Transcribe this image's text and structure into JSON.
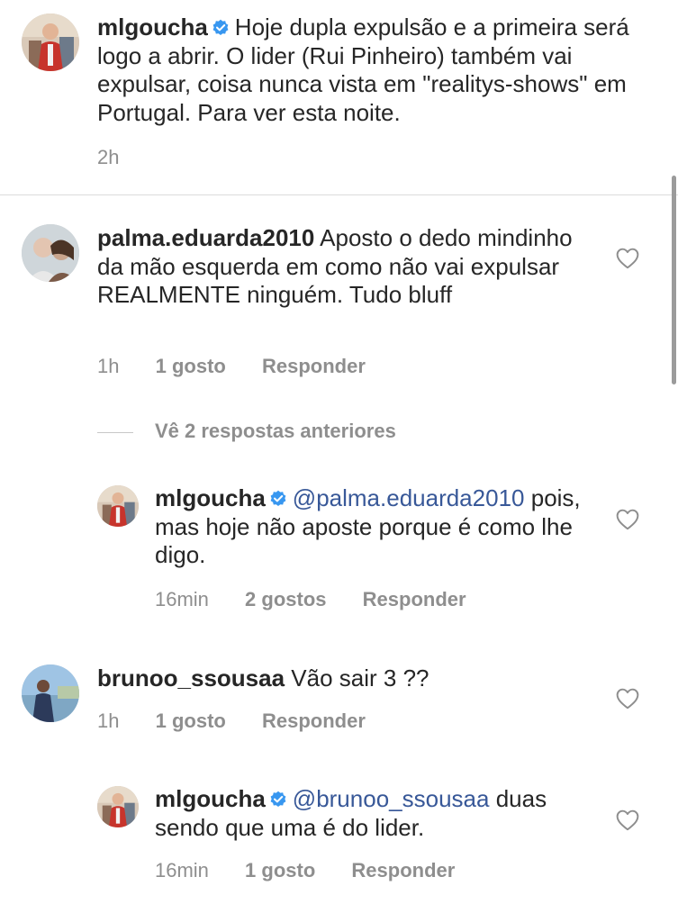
{
  "caption": {
    "username": "mlgoucha",
    "text": "Hoje  dupla expulsão e a primeira será logo a abrir. O lider (Rui Pinheiro) também vai expulsar, coisa nunca vista em \"realitys-shows\" em Portugal. Para ver esta noite.",
    "time": "2h"
  },
  "comments": [
    {
      "username": "palma.eduarda2010",
      "text": "Aposto o dedo mindinho da mão esquerda em como não vai expulsar REALMENTE ninguém. Tudo bluff",
      "time": "1h",
      "likes": "1 gosto",
      "reply_label": "Responder"
    },
    {
      "username": "brunoo_ssousaa",
      "text": "Vão sair 3 ??",
      "time": "1h",
      "likes": "1 gosto",
      "reply_label": "Responder"
    }
  ],
  "view_replies": "Vê 2 respostas anteriores",
  "replies": [
    {
      "username": "mlgoucha",
      "mention": "@palma.eduarda2010",
      "text": "pois, mas hoje não aposte porque é como lhe digo.",
      "time": "16min",
      "likes": "2 gostos",
      "reply_label": "Responder"
    },
    {
      "username": "mlgoucha",
      "mention": "@brunoo_ssousaa",
      "text": "duas sendo que uma é do lider.",
      "time": "16min",
      "likes": "1 gosto",
      "reply_label": "Responder"
    }
  ],
  "colors": {
    "verified": "#3897f0",
    "muted": "#8e8e8e",
    "mention": "#385898"
  }
}
